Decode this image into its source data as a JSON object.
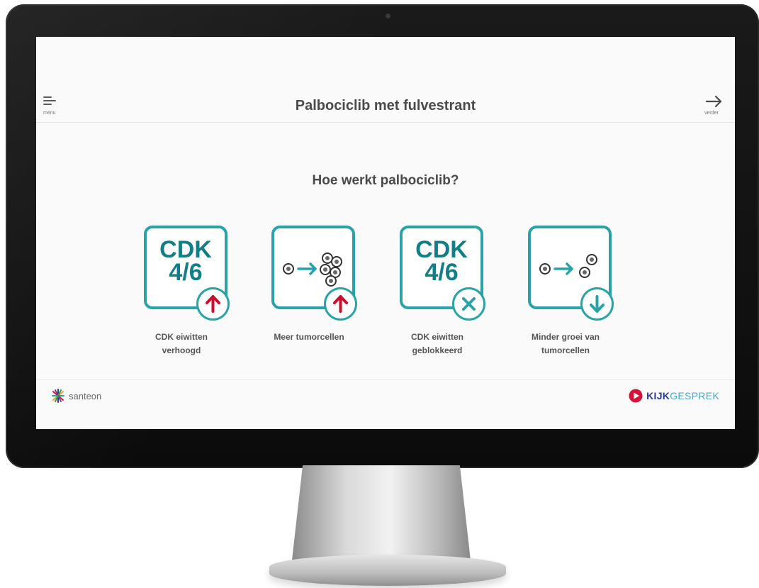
{
  "header": {
    "menu_label": "menu",
    "title": "Palbociclib met fulvestrant",
    "next_label": "verder"
  },
  "main": {
    "subtitle": "Hoe werkt palbociclib?",
    "cards": [
      {
        "tile_text": "CDK\n4/6",
        "tile_icon": "cdk-text",
        "badge_icon": "arrow-up-icon",
        "label": "CDK eiwitten\nverhoogd"
      },
      {
        "tile_text": "",
        "tile_icon": "cells-increase-icon",
        "badge_icon": "arrow-up-icon",
        "label": "Meer tumorcellen"
      },
      {
        "tile_text": "CDK\n4/6",
        "tile_icon": "cdk-text",
        "badge_icon": "close-icon",
        "label": "CDK eiwitten\ngeblokkeerd"
      },
      {
        "tile_text": "",
        "tile_icon": "cells-slower-icon",
        "badge_icon": "arrow-down-icon",
        "label": "Minder groei van\ntumorcellen"
      }
    ]
  },
  "footer": {
    "left_logo_text": "santeon",
    "right_logo_text_bold": "KIJK",
    "right_logo_text_light": "GESPREK"
  },
  "colors": {
    "teal": "#2aa3a8",
    "teal_dark": "#127e86",
    "red_arrow": "#c8102e",
    "text": "#4a4a4a",
    "kijk_blue": "#2a3c8f",
    "kijk_light": "#4aa8d0",
    "play_red": "#d5123a"
  }
}
